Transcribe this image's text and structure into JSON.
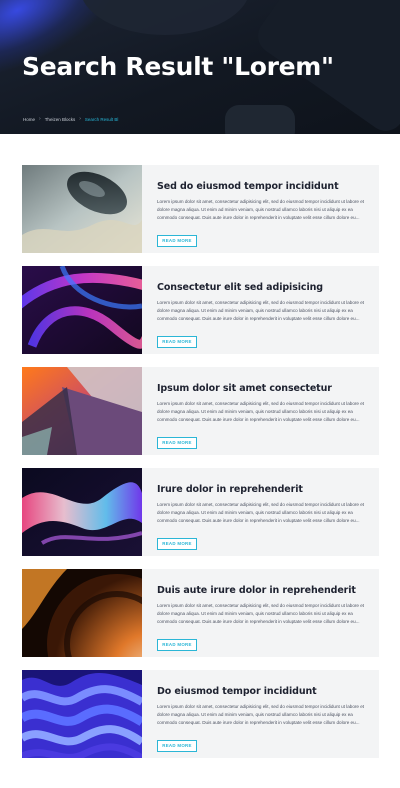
{
  "hero": {
    "title": "Search Result \"Lorem\"",
    "breadcrumb": [
      "Home",
      "Theizen Blocks",
      "Search Result Bl"
    ]
  },
  "results": [
    {
      "title": "Sed do eiusmod tempor incididunt",
      "text": "Lorem ipsum dolor sit amet, consectetur adipisicing elit, sed do eiusmod tempor incididunt ut labore et dolore magna aliqua. Ut enim ad minim veniam, quis nostrud ullamco laboris nisi ut aliquip ex ea commodo consequat. Duis aute irure dolor in reprehenderit in voluptate velit esse cillum dolore eu...",
      "button": "READ MORE",
      "image": "liquid-metal-blob-image"
    },
    {
      "title": "Consectetur elit sed adipisicing",
      "text": "Lorem ipsum dolor sit amet, consectetur adipisicing elit, sed do eiusmod tempor incididunt ut labore et dolore magna aliqua. Ut enim ad minim veniam, quis nostrud ullamco laboris nisi ut aliquip ex ea commodo consequat. Duis aute irure dolor in reprehenderit in voluptate velit esse cillum dolore eu...",
      "button": "READ MORE",
      "image": "purple-glass-loops-image"
    },
    {
      "title": "Ipsum dolor sit amet consectetur",
      "text": "Lorem ipsum dolor sit amet, consectetur adipisicing elit, sed do eiusmod tempor incididunt ut labore et dolore magna aliqua. Ut enim ad minim veniam, quis nostrud ullamco laboris nisi ut aliquip ex ea commodo consequat. Duis aute irure dolor in reprehenderit in voluptate velit esse cillum dolore eu...",
      "button": "READ MORE",
      "image": "orange-purple-planes-image"
    },
    {
      "title": "Irure dolor in reprehenderit",
      "text": "Lorem ipsum dolor sit amet, consectetur adipisicing elit, sed do eiusmod tempor incididunt ut labore et dolore magna aliqua. Ut enim ad minim veniam, quis nostrud ullamco laboris nisi ut aliquip ex ea commodo consequat. Duis aute irure dolor in reprehenderit in voluptate velit esse cillum dolore eu...",
      "button": "READ MORE",
      "image": "iridescent-ribbon-image"
    },
    {
      "title": "Duis aute irure dolor in reprehenderit",
      "text": "Lorem ipsum dolor sit amet, consectetur adipisicing elit, sed do eiusmod tempor incididunt ut labore et dolore magna aliqua. Ut enim ad minim veniam, quis nostrud ullamco laboris nisi ut aliquip ex ea commodo consequat. Duis aute irure dolor in reprehenderit in voluptate velit esse cillum dolore eu...",
      "button": "READ MORE",
      "image": "orange-metallic-disc-image"
    },
    {
      "title": "Do eiusmod tempor incididunt",
      "text": "Lorem ipsum dolor sit amet, consectetur adipisicing elit, sed do eiusmod tempor incididunt ut labore et dolore magna aliqua. Ut enim ad minim veniam, quis nostrud ullamco laboris nisi ut aliquip ex ea commodo consequat. Duis aute irure dolor in reprehenderit in voluptate velit esse cillum dolore eu...",
      "button": "READ MORE",
      "image": "blue-wavy-layers-image"
    }
  ],
  "colors": {
    "accent": "#2bb6d6",
    "hero_bg": "#121822",
    "card_bg": "#f3f4f5",
    "title": "#1e2230"
  }
}
